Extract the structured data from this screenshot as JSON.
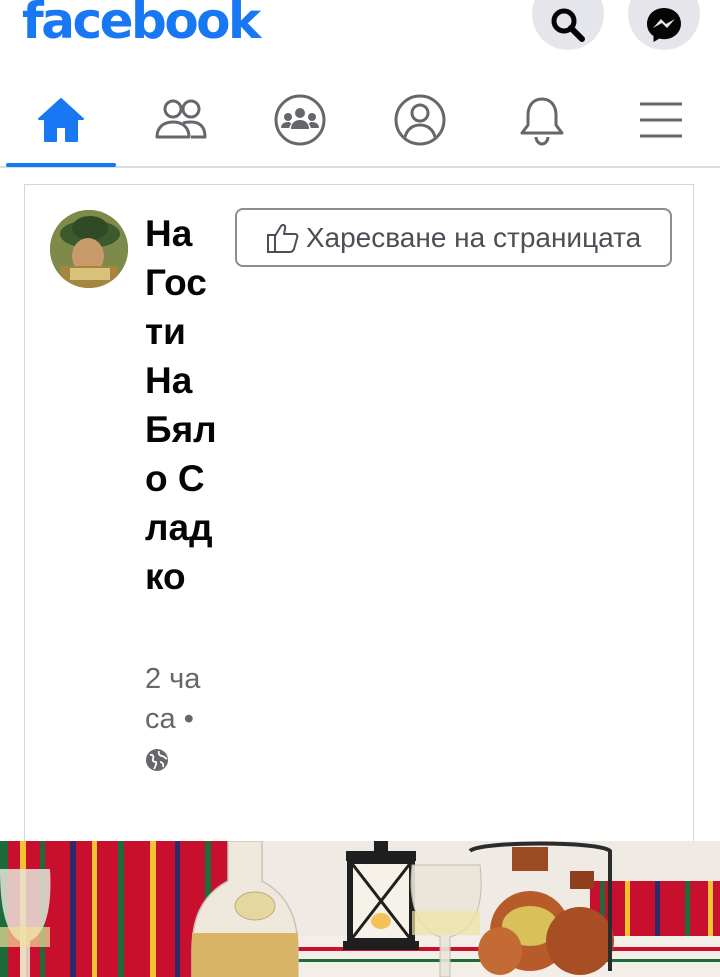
{
  "header": {
    "logo_text": "facebook",
    "brand_color": "#1877f2",
    "search_icon": "search-icon",
    "messenger_icon": "messenger-icon"
  },
  "nav": {
    "tabs": [
      {
        "name": "home",
        "icon": "home-icon",
        "active": true
      },
      {
        "name": "friends",
        "icon": "friends-icon",
        "active": false
      },
      {
        "name": "groups",
        "icon": "groups-icon",
        "active": false
      },
      {
        "name": "profile",
        "icon": "profile-icon",
        "active": false
      },
      {
        "name": "notifications",
        "icon": "bell-icon",
        "active": false
      },
      {
        "name": "menu",
        "icon": "hamburger-menu-icon",
        "active": false
      }
    ]
  },
  "post": {
    "page_name": "На Гости На Бяло Сладко",
    "time": "2 часа",
    "separator": "•",
    "privacy_icon": "globe-icon",
    "like_page_label": "Харесване на страницата"
  }
}
